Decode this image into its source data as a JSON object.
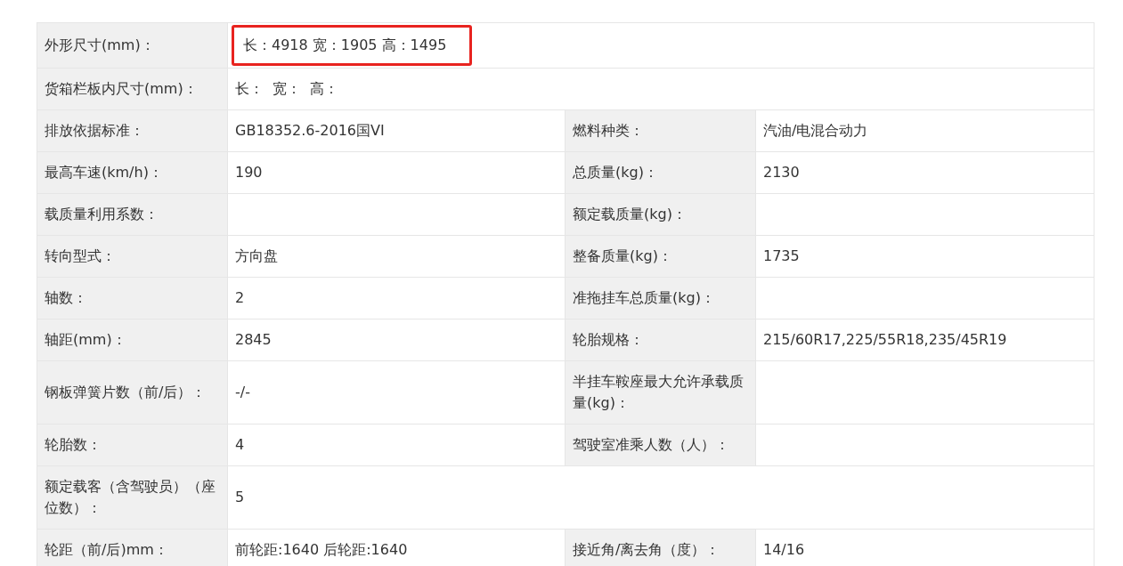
{
  "spec_table": {
    "rows": [
      {
        "kind": "full",
        "label": "外形尺寸(mm)：",
        "value": "长：4918 宽：1905 高：1495",
        "highlighted": true
      },
      {
        "kind": "full",
        "label": "货箱栏板内尺寸(mm)：",
        "value": "长：  宽：  高：",
        "highlighted": false
      },
      {
        "kind": "pair",
        "label": "排放依据标准：",
        "value": "GB18352.6-2016国VI",
        "label2": "燃料种类：",
        "value2": "汽油/电混合动力"
      },
      {
        "kind": "pair",
        "label": "最高车速(km/h)：",
        "value": "190",
        "label2": "总质量(kg)：",
        "value2": "2130"
      },
      {
        "kind": "pair",
        "label": "载质量利用系数：",
        "value": "",
        "label2": "额定载质量(kg)：",
        "value2": ""
      },
      {
        "kind": "pair",
        "label": "转向型式：",
        "value": "方向盘",
        "label2": "整备质量(kg)：",
        "value2": "1735"
      },
      {
        "kind": "pair",
        "label": "轴数：",
        "value": "2",
        "label2": "准拖挂车总质量(kg)：",
        "value2": ""
      },
      {
        "kind": "pair",
        "label": "轴距(mm)：",
        "value": "2845",
        "label2": "轮胎规格：",
        "value2": "215/60R17,225/55R18,235/45R19"
      },
      {
        "kind": "pair",
        "label": "钢板弹簧片数（前/后）：",
        "value": "-/-",
        "label2": "半挂车鞍座最大允许承载质量(kg)：",
        "value2": ""
      },
      {
        "kind": "pair",
        "label": "轮胎数：",
        "value": "4",
        "label2": "驾驶室准乘人数（人）：",
        "value2": ""
      },
      {
        "kind": "full",
        "label": "额定载客（含驾驶员）（座位数）：",
        "value": "5",
        "highlighted": false
      },
      {
        "kind": "pair",
        "label": "轮距（前/后)mm：",
        "value": "前轮距:1640 后轮距:1640",
        "label2": "接近角/离去角（度）：",
        "value2": "14/16"
      }
    ]
  }
}
